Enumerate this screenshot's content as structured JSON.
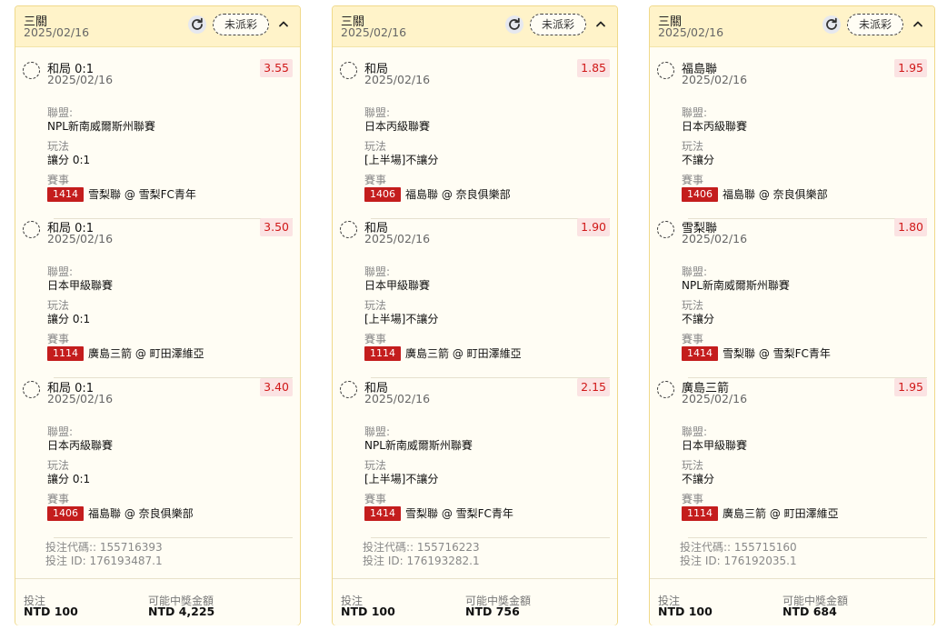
{
  "cards": [
    {
      "title": "三關",
      "date": "2025/02/16",
      "status": "未派彩",
      "legs": [
        {
          "selection": "和局 0:1",
          "date": "2025/02/16",
          "odds": "3.55",
          "league_label": "聯盟:",
          "league": "NPL新南威爾斯州聯賽",
          "bettype_label": "玩法",
          "bettype": "讓分 0:1",
          "event_label": "賽事",
          "event_code": "1414",
          "event_name": "雪梨聯 @ 雪梨FC青年"
        },
        {
          "selection": "和局 0:1",
          "date": "2025/02/16",
          "odds": "3.50",
          "league_label": "聯盟:",
          "league": "日本甲級聯賽",
          "bettype_label": "玩法",
          "bettype": "讓分 0:1",
          "event_label": "賽事",
          "event_code": "1114",
          "event_name": "廣島三箭 @ 町田澤維亞"
        },
        {
          "selection": "和局 0:1",
          "date": "2025/02/16",
          "odds": "3.40",
          "league_label": "聯盟:",
          "league": "日本丙級聯賽",
          "bettype_label": "玩法",
          "bettype": "讓分 0:1",
          "event_label": "賽事",
          "event_code": "1406",
          "event_name": "福島聯 @ 奈良俱樂部"
        }
      ],
      "bet_code": "投注代碼:: 155716393",
      "bet_id": "投注 ID: 176193487.1",
      "stake_label": "投注",
      "stake": "NTD 100",
      "payout_label": "可能中獎金額",
      "payout": "NTD 4,225"
    },
    {
      "title": "三關",
      "date": "2025/02/16",
      "status": "未派彩",
      "legs": [
        {
          "selection": "和局",
          "date": "2025/02/16",
          "odds": "1.85",
          "league_label": "聯盟:",
          "league": "日本丙級聯賽",
          "bettype_label": "玩法",
          "bettype": "[上半場]不讓分",
          "event_label": "賽事",
          "event_code": "1406",
          "event_name": "福島聯 @ 奈良俱樂部"
        },
        {
          "selection": "和局",
          "date": "2025/02/16",
          "odds": "1.90",
          "league_label": "聯盟:",
          "league": "日本甲級聯賽",
          "bettype_label": "玩法",
          "bettype": "[上半場]不讓分",
          "event_label": "賽事",
          "event_code": "1114",
          "event_name": "廣島三箭 @ 町田澤維亞"
        },
        {
          "selection": "和局",
          "date": "2025/02/16",
          "odds": "2.15",
          "league_label": "聯盟:",
          "league": "NPL新南威爾斯州聯賽",
          "bettype_label": "玩法",
          "bettype": "[上半場]不讓分",
          "event_label": "賽事",
          "event_code": "1414",
          "event_name": "雪梨聯 @ 雪梨FC青年"
        }
      ],
      "bet_code": "投注代碼:: 155716223",
      "bet_id": "投注 ID: 176193282.1",
      "stake_label": "投注",
      "stake": "NTD 100",
      "payout_label": "可能中獎金額",
      "payout": "NTD 756"
    },
    {
      "title": "三關",
      "date": "2025/02/16",
      "status": "未派彩",
      "legs": [
        {
          "selection": "福島聯",
          "date": "2025/02/16",
          "odds": "1.95",
          "league_label": "聯盟:",
          "league": "日本丙級聯賽",
          "bettype_label": "玩法",
          "bettype": "不讓分",
          "event_label": "賽事",
          "event_code": "1406",
          "event_name": "福島聯 @ 奈良俱樂部"
        },
        {
          "selection": "雪梨聯",
          "date": "2025/02/16",
          "odds": "1.80",
          "league_label": "聯盟:",
          "league": "NPL新南威爾斯州聯賽",
          "bettype_label": "玩法",
          "bettype": "不讓分",
          "event_label": "賽事",
          "event_code": "1414",
          "event_name": "雪梨聯 @ 雪梨FC青年"
        },
        {
          "selection": "廣島三箭",
          "date": "2025/02/16",
          "odds": "1.95",
          "league_label": "聯盟:",
          "league": "日本甲級聯賽",
          "bettype_label": "玩法",
          "bettype": "不讓分",
          "event_label": "賽事",
          "event_code": "1114",
          "event_name": "廣島三箭 @ 町田澤維亞"
        }
      ],
      "bet_code": "投注代碼:: 155715160",
      "bet_id": "投注 ID: 176192035.1",
      "stake_label": "投注",
      "stake": "NTD 100",
      "payout_label": "可能中獎金額",
      "payout": "NTD 684"
    }
  ],
  "icons": {
    "refresh": "refresh-icon",
    "collapse": "chevron-up-icon"
  },
  "colors": {
    "header_bg": "#fff3c9",
    "border": "#f0d98a",
    "odds_text": "#d01818",
    "odds_bg": "#fbe3e3",
    "event_badge": "#c41d1d"
  }
}
